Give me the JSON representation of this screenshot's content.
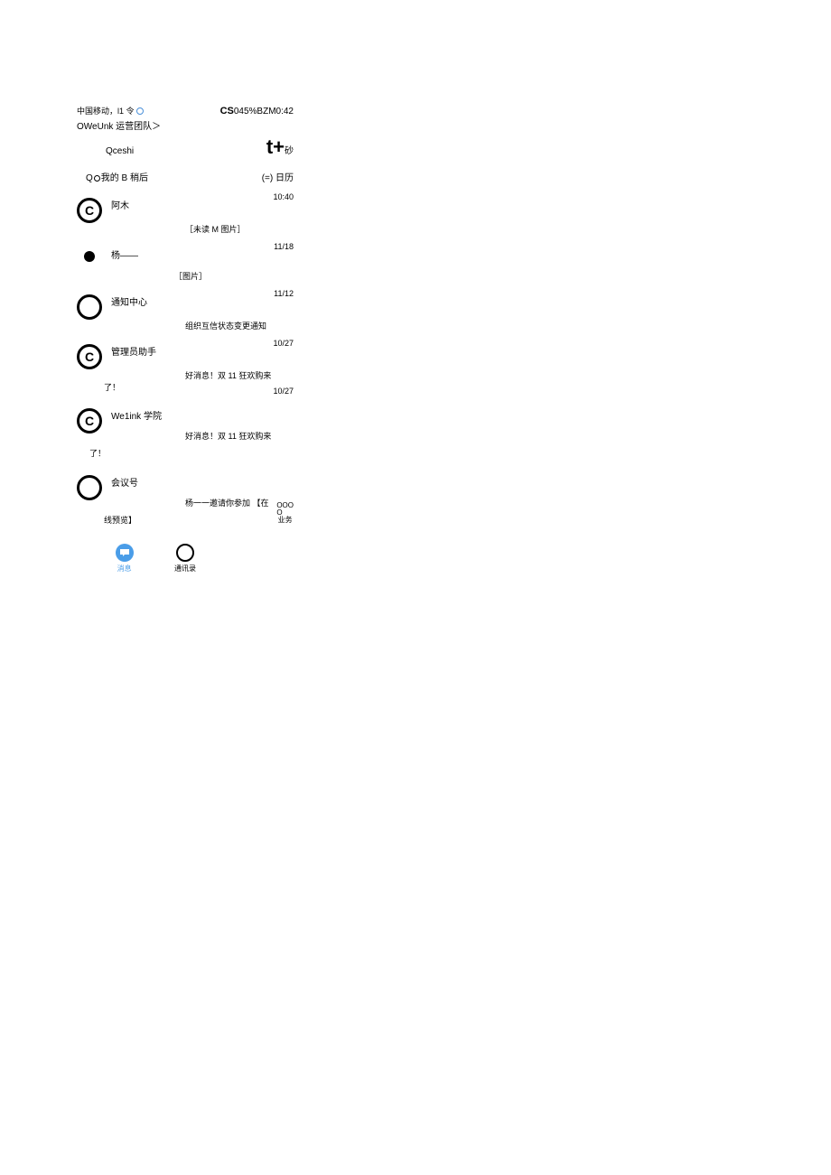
{
  "status": {
    "carrier": "中国移动，l1 令",
    "right": {
      "cs": "CS",
      "rest": "045%BZM0:42"
    }
  },
  "header": {
    "title": "OWeUnk 运营团队＞"
  },
  "qceshi": "Qceshi",
  "tplus": {
    "t": "t+",
    "sub": "砂"
  },
  "row2": {
    "left_pre": "Q",
    "left_mid": "我的 B 稍后",
    "cal_prefix": "(=)",
    "cal": "日历"
  },
  "chats": [
    {
      "avatar_letter": "C",
      "name": "阿木",
      "preview": "［未读 M 图片］",
      "time": "10:40"
    },
    {
      "avatar_type": "dot",
      "name": "杨——",
      "preview": "［图片］",
      "time": "11/18"
    },
    {
      "avatar_type": "ring",
      "name": "通知中心",
      "preview": "组织互信状态变更通知",
      "time": "11/12"
    },
    {
      "avatar_letter": "C",
      "name": "管理员助手",
      "preview": "好消息！双 11 狂欢购来",
      "preview2": "了！",
      "time": "10/27"
    },
    {
      "avatar_letter": "C",
      "name": "We1ink 学院",
      "preview": "好消息！双 11 狂欢购来",
      "preview2": "了！",
      "time": "10/27"
    },
    {
      "avatar_type": "ring",
      "name": "会议号",
      "preview": "杨一一邀请你参加 【在",
      "preview2": "线预览】",
      "time": ""
    }
  ],
  "biz": {
    "dots": "OOO\nO",
    "label": "业务"
  },
  "tabs": {
    "t1": "消息",
    "t2": "通讯录"
  }
}
